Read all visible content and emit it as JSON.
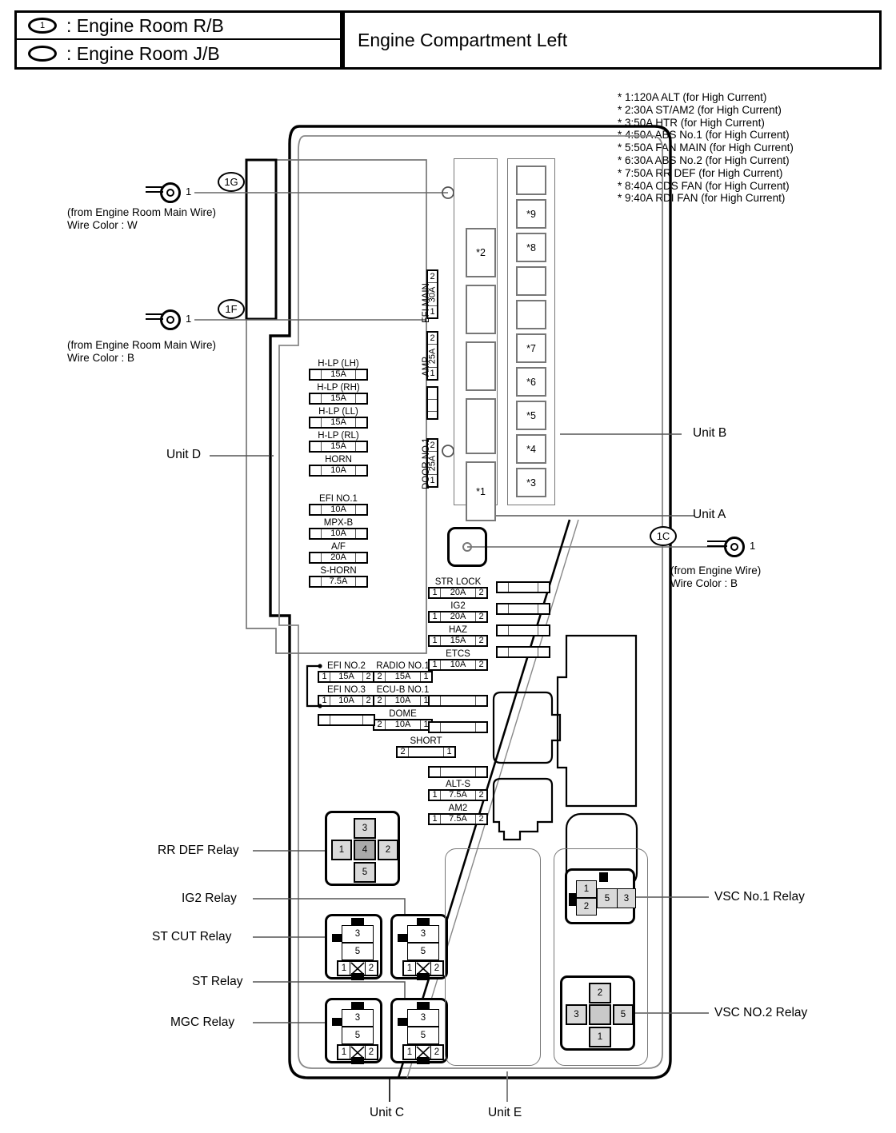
{
  "legend": {
    "rows": [
      {
        "symbol": "1",
        "symbol_name": "engine-room-rb-symbol",
        "text": ": Engine Room R/B"
      },
      {
        "symbol": "",
        "symbol_name": "engine-room-jb-symbol",
        "text": ": Engine Room J/B"
      }
    ]
  },
  "header": {
    "title": "Engine Compartment Left"
  },
  "high_current_notes": [
    "* 1:120A ALT (for High Current)",
    "* 2:30A ST/AM2 (for High Current)",
    "* 3:50A HTR (for High Current)",
    "* 4:50A ABS No.1 (for High Current)",
    "* 5:50A FAN MAIN (for High Current)",
    "* 6:30A ABS No.2 (for High Current)",
    "* 7:50A RR DEF (for High Current)",
    "* 8:40A CDS FAN (for High Current)",
    "* 9:40A RDI FAN (for High Current)"
  ],
  "connectors": [
    {
      "id": "1G",
      "pin": "1",
      "source": "(from Engine Room Main Wire)",
      "wire_color": "Wire Color : W"
    },
    {
      "id": "1F",
      "pin": "1",
      "source": "(from Engine Room Main Wire)",
      "wire_color": "Wire Color : B"
    },
    {
      "id": "1C",
      "pin": "1",
      "source": "(from Engine Wire)",
      "wire_color": "Wire Color : B"
    }
  ],
  "unit_labels": {
    "unit_a": "Unit A",
    "unit_b": "Unit B",
    "unit_c": "Unit C",
    "unit_d": "Unit D",
    "unit_e": "Unit E"
  },
  "unit_d_fuses_upper": [
    {
      "label": "H-LP (LH)",
      "left": "",
      "rating": "15A",
      "right": ""
    },
    {
      "label": "H-LP (RH)",
      "left": "",
      "rating": "15A",
      "right": ""
    },
    {
      "label": "H-LP (LL)",
      "left": "",
      "rating": "15A",
      "right": ""
    },
    {
      "label": "H-LP (RL)",
      "left": "",
      "rating": "15A",
      "right": ""
    },
    {
      "label": "HORN",
      "left": "",
      "rating": "10A",
      "right": ""
    }
  ],
  "unit_d_fuses_lower": [
    {
      "label": "EFI NO.1",
      "left": "",
      "rating": "10A",
      "right": ""
    },
    {
      "label": "MPX-B",
      "left": "",
      "rating": "10A",
      "right": ""
    },
    {
      "label": "A/F",
      "left": "",
      "rating": "20A",
      "right": ""
    },
    {
      "label": "S-HORN",
      "left": "",
      "rating": "7.5A",
      "right": ""
    }
  ],
  "vertical_fuses": [
    {
      "label": "EFI MAIN",
      "top": "2",
      "rating": "30A",
      "bottom": "1"
    },
    {
      "label": "AMP",
      "top": "2",
      "rating": "25A",
      "bottom": "1"
    },
    {
      "label": "DOOR NO.1",
      "top": "2",
      "rating": "25A",
      "bottom": "1"
    }
  ],
  "unit_a_slots": [
    "*2",
    "",
    "",
    "",
    "*1"
  ],
  "unit_b_slots": [
    "",
    "*9",
    "*8",
    "",
    "",
    "*7",
    "*6",
    "*5",
    "*4",
    "*3"
  ],
  "center_fuses_col1": [
    {
      "label": "EFI NO.2",
      "left": "1",
      "rating": "15A",
      "right": "2"
    },
    {
      "label": "EFI NO.3",
      "left": "1",
      "rating": "10A",
      "right": "2"
    }
  ],
  "center_fuses_col2": [
    {
      "label": "RADIO NO.1",
      "left": "2",
      "rating": "15A",
      "right": "1"
    },
    {
      "label": "ECU-B NO.1",
      "left": "2",
      "rating": "10A",
      "right": "1"
    },
    {
      "label": "DOME",
      "left": "2",
      "rating": "10A",
      "right": "1"
    }
  ],
  "center_fuses_col3": [
    {
      "label": "STR LOCK",
      "left": "1",
      "rating": "20A",
      "right": "2"
    },
    {
      "label": "IG2",
      "left": "1",
      "rating": "20A",
      "right": "2"
    },
    {
      "label": "HAZ",
      "left": "1",
      "rating": "15A",
      "right": "2"
    },
    {
      "label": "ETCS",
      "left": "1",
      "rating": "10A",
      "right": "2"
    }
  ],
  "center_fuses_bottom": [
    {
      "label": "SHORT",
      "left": "2",
      "rating": "",
      "right": "1"
    },
    {
      "label": "ALT-S",
      "left": "1",
      "rating": "7.5A",
      "right": "2"
    },
    {
      "label": "AM2",
      "left": "1",
      "rating": "7.5A",
      "right": "2"
    }
  ],
  "relays_left": [
    {
      "name": "RR DEF Relay",
      "pins": [
        "1",
        "2",
        "3",
        "4",
        "5"
      ],
      "type": "cross"
    },
    {
      "name": "IG2 Relay",
      "pins": [
        "1",
        "2",
        "3",
        "5"
      ],
      "type": "square"
    },
    {
      "name": "ST CUT Relay",
      "pins": [
        "1",
        "2",
        "3",
        "5"
      ],
      "type": "square"
    },
    {
      "name": "ST Relay",
      "pins": [
        "1",
        "2",
        "3",
        "5"
      ],
      "type": "square"
    },
    {
      "name": "MGC Relay",
      "pins": [
        "1",
        "2",
        "3",
        "5"
      ],
      "type": "square"
    }
  ],
  "relays_right": [
    {
      "name": "VSC No.1 Relay",
      "pins": [
        "1",
        "2",
        "5",
        "3"
      ],
      "type": "flat"
    },
    {
      "name": "VSC NO.2 Relay",
      "pins": [
        "2",
        "3",
        "5",
        "1"
      ],
      "type": "cross"
    }
  ]
}
